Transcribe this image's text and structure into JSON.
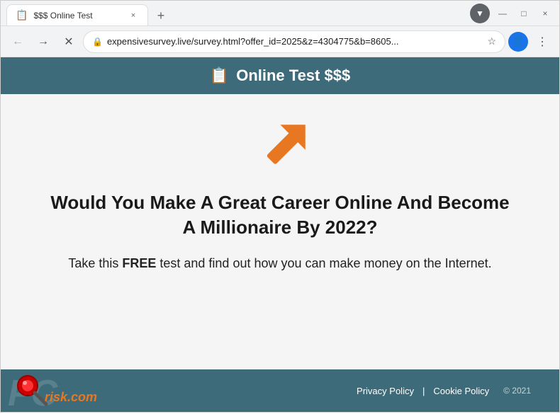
{
  "browser": {
    "tab": {
      "favicon": "📋",
      "title": "$$$ Online Test",
      "close_label": "×"
    },
    "new_tab_label": "+",
    "window_controls": {
      "minimize": "—",
      "maximize": "□",
      "close": "×"
    },
    "nav": {
      "back_label": "←",
      "forward_label": "→",
      "reload_label": "✕"
    },
    "url": "expensivesurvey.live/survey.html?offer_id=2025&z=4304775&b=8605...",
    "profile_icon": "👤",
    "menu_icon": "⋮",
    "extensions_icon": "⬇"
  },
  "page": {
    "header": {
      "icon": "📋",
      "title": "Online Test $$$"
    },
    "main": {
      "heading": "Would You Make A Great Career Online And Become A Millionaire By 2022?",
      "subtext_prefix": "Take this ",
      "subtext_bold": "FREE",
      "subtext_suffix": " test and find out how you can make money on the Internet."
    },
    "footer": {
      "privacy_policy": "Privacy Policy",
      "cookie_policy": "Cookie Policy",
      "year": "© 2021",
      "logo_pc": "PC",
      "logo_risk": "risk.com"
    }
  }
}
